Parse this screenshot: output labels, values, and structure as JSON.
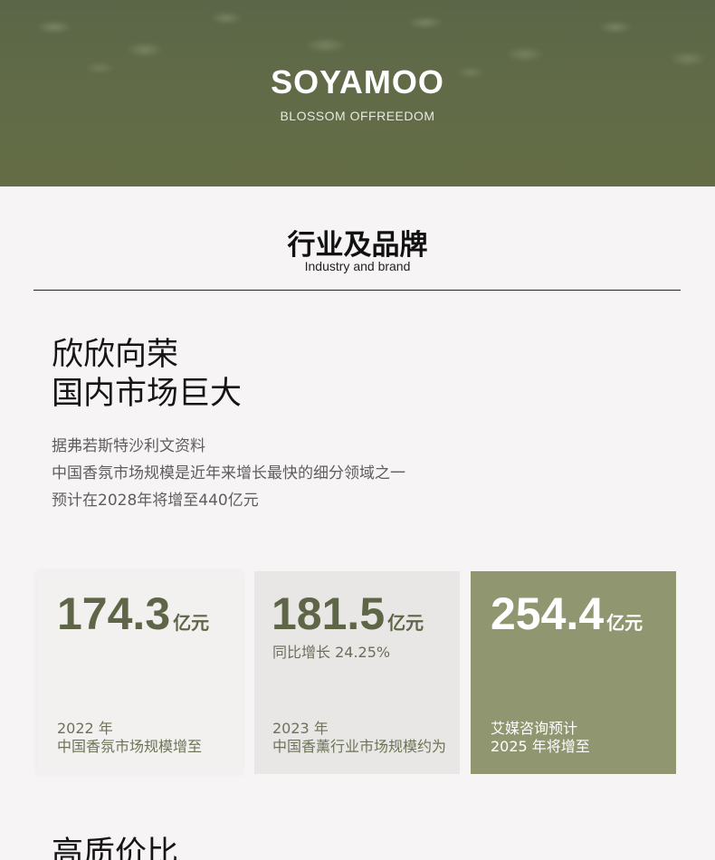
{
  "hero": {
    "logo": "SOYAMOO",
    "tagline": "BLOSSOM OFFREEDOM"
  },
  "section": {
    "title": "行业及品牌",
    "subtitle": "Industry and brand"
  },
  "headline": {
    "line1": "欣欣向荣",
    "line2": "国内市场巨大"
  },
  "paragraph": {
    "line1": "据弗若斯特沙利文资料",
    "line2": "中国香氛市场规模是近年来增长最快的细分领域之一",
    "line3": "预计在2028年将增至440亿元"
  },
  "stats": [
    {
      "value": "174.3",
      "unit": "亿元",
      "sub": "",
      "line1": "2022 年",
      "line2": "中国香氛市场规模增至"
    },
    {
      "value": "181.5",
      "unit": "亿元",
      "sub": "同比增长 24.25%",
      "line1": "2023 年",
      "line2": "中国香薰行业市场规模约为"
    },
    {
      "value": "254.4",
      "unit": "亿元",
      "sub": "",
      "line1": "艾媒咨询预计",
      "line2": "2025 年将增至"
    }
  ],
  "next_section": {
    "title": "高质价比"
  },
  "colors": {
    "hero_green": "#616b48",
    "accent_olive": "#8f9670",
    "number_olive": "#5f6647"
  }
}
